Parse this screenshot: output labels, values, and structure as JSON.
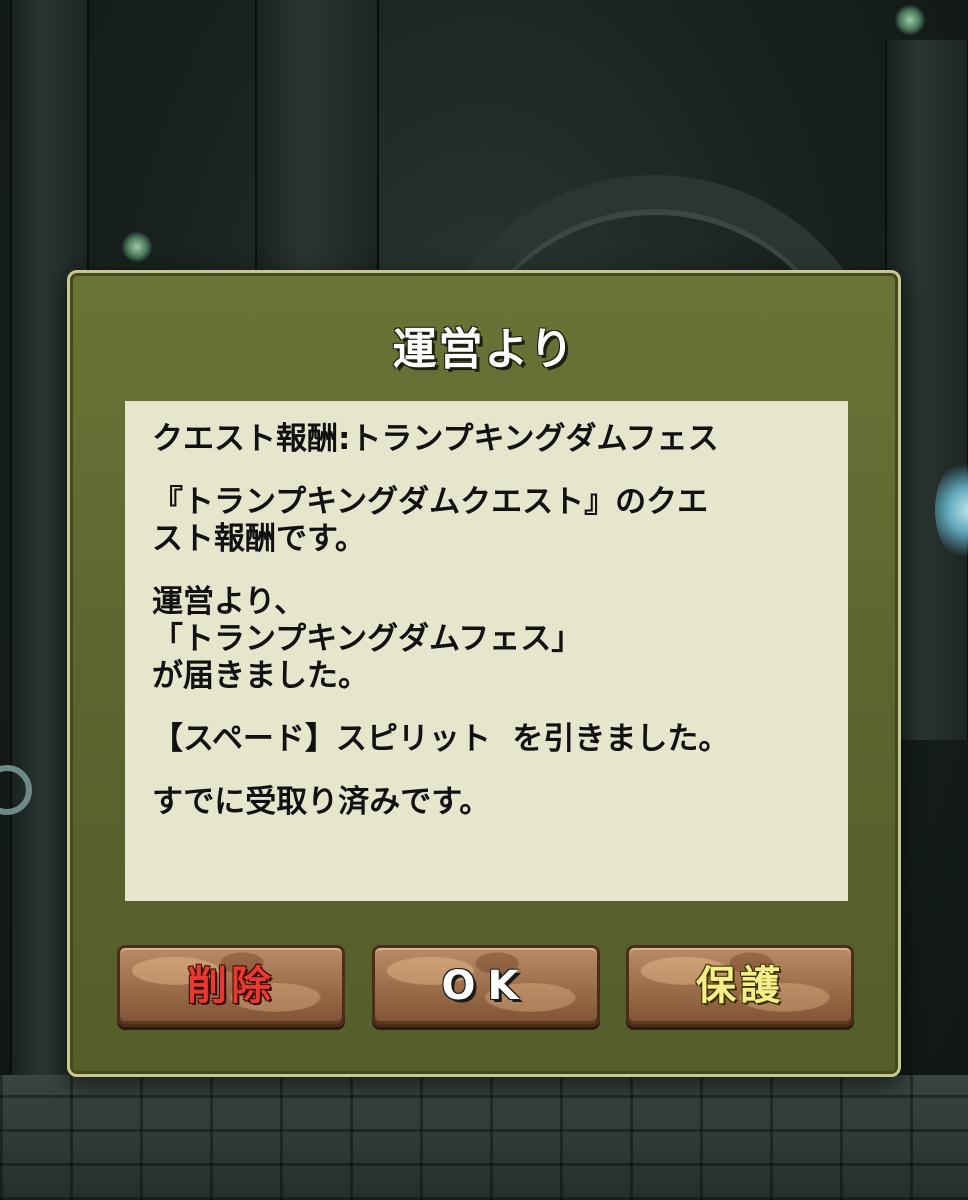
{
  "dialog": {
    "title": "運営より",
    "message_paragraphs": [
      "クエスト報酬:トランプキングダムフェス",
      "『トランプキングダムクエスト』のクエ\nスト報酬です。",
      "運営より、\n「トランプキングダムフェス」\nが届きました。",
      "【スペード】スピリット  を引きました。",
      "すでに受取り済みです。"
    ]
  },
  "buttons": {
    "delete_label": "削除",
    "ok_label": "OK",
    "protect_label": "保護"
  },
  "colors": {
    "dialog_bg": "#5c6530",
    "message_bg": "#e6e6cc",
    "delete_text": "#e83a2e",
    "ok_text": "#ffffff",
    "protect_text": "#f6f08a"
  }
}
